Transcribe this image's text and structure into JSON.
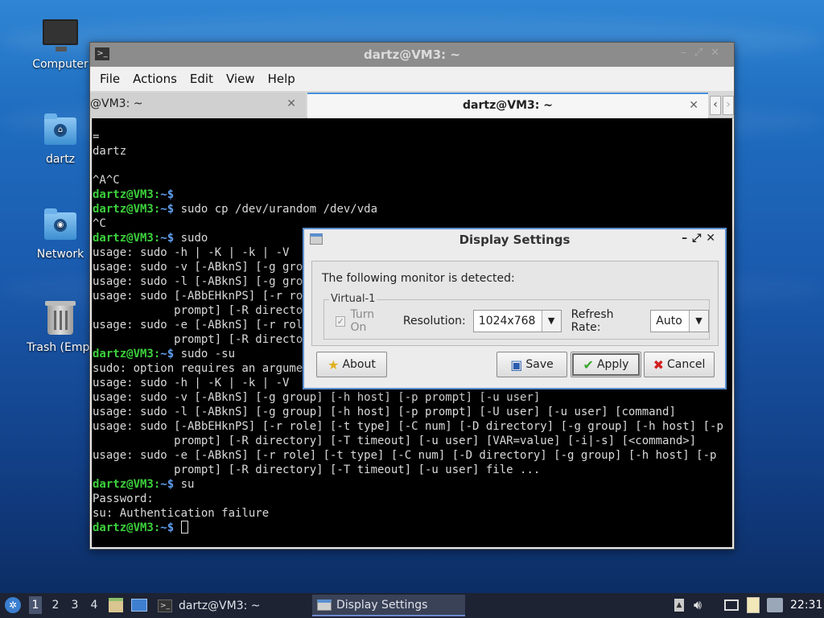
{
  "desktop": {
    "icons": [
      {
        "label": "Computer"
      },
      {
        "label": "dartz"
      },
      {
        "label": "Network"
      },
      {
        "label": "Trash (Empt"
      }
    ]
  },
  "terminal": {
    "title": "dartz@VM3: ~",
    "menu": [
      "File",
      "Actions",
      "Edit",
      "View",
      "Help"
    ],
    "tabs": [
      {
        "label": "@VM3: ~"
      },
      {
        "label": "dartz@VM3: ~"
      }
    ],
    "prompt_user": "dartz@VM3",
    "prompt_path": "~",
    "lines": [
      {
        "t": "="
      },
      {
        "t": "dartz"
      },
      {
        "t": ""
      },
      {
        "t": "^A^C"
      },
      {
        "p": true,
        "t": ""
      },
      {
        "p": true,
        "t": "sudo cp /dev/urandom /dev/vda"
      },
      {
        "t": "^C"
      },
      {
        "p": true,
        "t": "sudo"
      },
      {
        "t": "usage: sudo -h | -K | -k | -V"
      },
      {
        "t": "usage: sudo -v [-ABknS] [-g group] [-h host] [-p prompt] [-u user]"
      },
      {
        "t": "usage: sudo -l [-ABknS] [-g group] [-h host] [-p prompt] [-U user] [-u user] [command]"
      },
      {
        "t": "usage: sudo [-ABbEHknPS] [-r role] [-t type] [-C num] [-D directory] [-g group] [-h host] [-p"
      },
      {
        "t": "            prompt] [-R directory] [-T timeout] [-u user] [VAR=value] [-i|-s] [<command>]"
      },
      {
        "t": "usage: sudo -e [-ABknS] [-r role] [-t type] [-C num] [-D directory] [-g group] [-h host] [-p"
      },
      {
        "t": "            prompt] [-R directory] [-T timeout] [-u user] file ..."
      },
      {
        "p": true,
        "t": "sudo -su"
      },
      {
        "t": "sudo: option requires an argument -- 'u'"
      },
      {
        "t": "usage: sudo -h | -K | -k | -V"
      },
      {
        "t": "usage: sudo -v [-ABknS] [-g group] [-h host] [-p prompt] [-u user]"
      },
      {
        "t": "usage: sudo -l [-ABknS] [-g group] [-h host] [-p prompt] [-U user] [-u user] [command]"
      },
      {
        "t": "usage: sudo [-ABbEHknPS] [-r role] [-t type] [-C num] [-D directory] [-g group] [-h host] [-p"
      },
      {
        "t": "            prompt] [-R directory] [-T timeout] [-u user] [VAR=value] [-i|-s] [<command>]"
      },
      {
        "t": "usage: sudo -e [-ABknS] [-r role] [-t type] [-C num] [-D directory] [-g group] [-h host] [-p"
      },
      {
        "t": "            prompt] [-R directory] [-T timeout] [-u user] file ..."
      },
      {
        "p": true,
        "t": "su"
      },
      {
        "t": "Password:"
      },
      {
        "t": "su: Authentication failure"
      },
      {
        "p": true,
        "t": "",
        "cursor": true
      }
    ]
  },
  "dialog": {
    "title": "Display Settings",
    "message": "The following monitor is detected:",
    "monitor": "Virtual-1",
    "turn_on_label": "Turn On",
    "resolution_label": "Resolution:",
    "resolution_value": "1024x768",
    "refresh_label": "Refresh Rate:",
    "refresh_value": "Auto",
    "about_label": "About",
    "save_label": "Save",
    "apply_label": "Apply",
    "cancel_label": "Cancel"
  },
  "taskbar": {
    "workspaces": [
      "1",
      "2",
      "3",
      "4"
    ],
    "tasks": [
      {
        "label": "dartz@VM3: ~"
      },
      {
        "label": "Display Settings"
      }
    ],
    "clock": "22:31"
  }
}
